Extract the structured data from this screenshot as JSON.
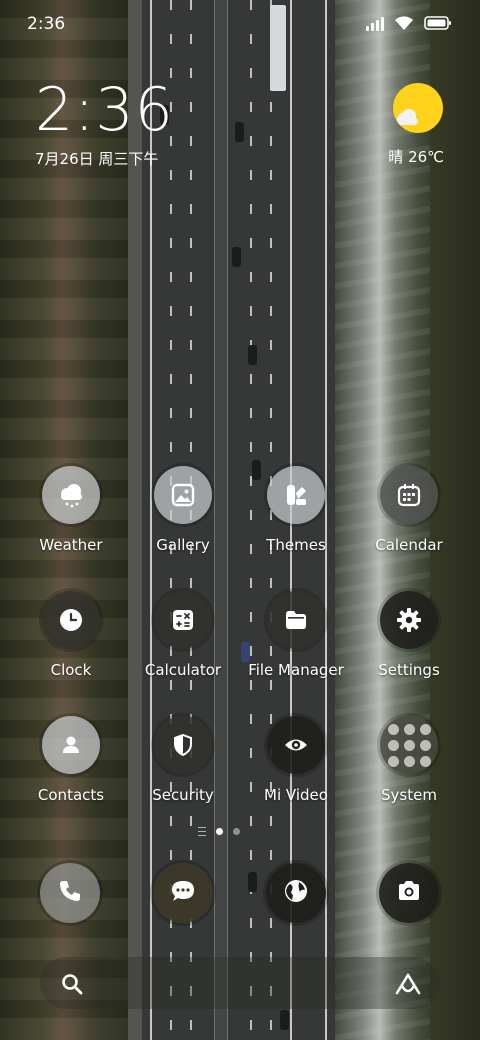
{
  "status_bar": {
    "time": "2:36"
  },
  "clock_widget": {
    "time": "2:36",
    "date": "7月26日 周三下午"
  },
  "weather_widget": {
    "text": "晴 26℃"
  },
  "apps": [
    {
      "id": "weather",
      "label": "Weather",
      "icon": "cloud-rain-icon"
    },
    {
      "id": "gallery",
      "label": "Gallery",
      "icon": "image-icon"
    },
    {
      "id": "themes",
      "label": "Themes",
      "icon": "palette-icon"
    },
    {
      "id": "calendar",
      "label": "Calendar",
      "icon": "calendar-icon"
    },
    {
      "id": "clock",
      "label": "Clock",
      "icon": "clock-icon"
    },
    {
      "id": "calculator",
      "label": "Calculator",
      "icon": "calculator-icon"
    },
    {
      "id": "file-manager",
      "label": "File Manager",
      "icon": "folder-icon"
    },
    {
      "id": "settings",
      "label": "Settings",
      "icon": "gear-icon"
    },
    {
      "id": "contacts",
      "label": "Contacts",
      "icon": "person-icon"
    },
    {
      "id": "security",
      "label": "Security",
      "icon": "shield-icon"
    },
    {
      "id": "mi-video",
      "label": "Mi Video",
      "icon": "eye-icon"
    },
    {
      "id": "system",
      "label": "System",
      "icon": "folder-grid-icon"
    }
  ],
  "dock": [
    {
      "id": "phone",
      "icon": "phone-icon"
    },
    {
      "id": "messages",
      "icon": "chat-bubble-icon"
    },
    {
      "id": "browser",
      "icon": "globe-icon"
    },
    {
      "id": "camera",
      "icon": "camera-icon"
    }
  ],
  "page_indicator": {
    "pages": 2,
    "active": 1
  },
  "colors": {
    "sun": "#ffd31a",
    "icon_light_bg": "#c8ccce",
    "icon_dark_bg": "#30302c"
  }
}
